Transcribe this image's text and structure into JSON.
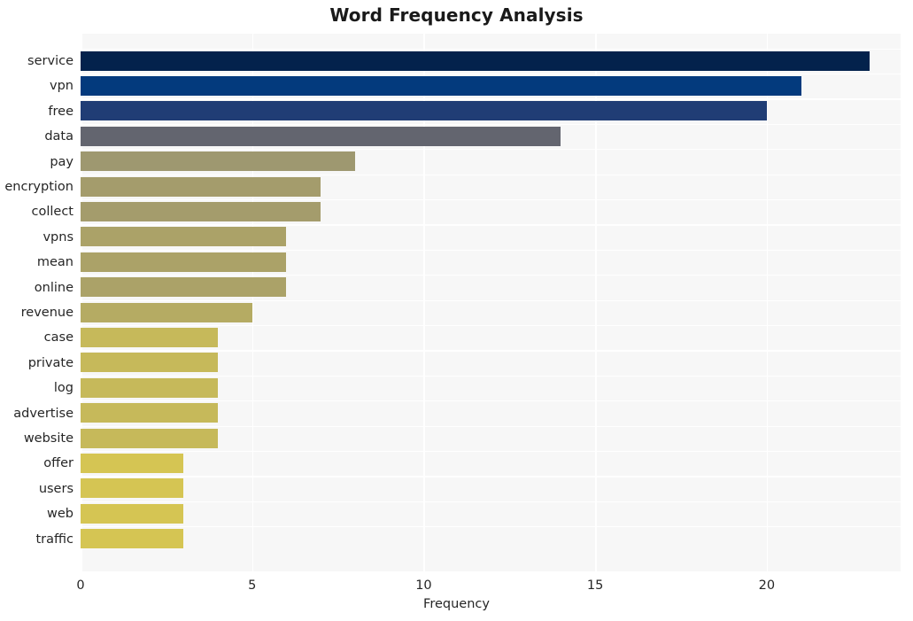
{
  "chart_data": {
    "type": "bar",
    "orientation": "horizontal",
    "title": "Word Frequency Analysis",
    "xlabel": "Frequency",
    "ylabel": "",
    "categories": [
      "service",
      "vpn",
      "free",
      "data",
      "pay",
      "encryption",
      "collect",
      "vpns",
      "mean",
      "online",
      "revenue",
      "case",
      "private",
      "log",
      "advertise",
      "website",
      "offer",
      "users",
      "web",
      "traffic"
    ],
    "values": [
      23,
      21,
      20,
      14,
      8,
      7,
      7,
      6,
      6,
      6,
      5,
      4,
      4,
      4,
      4,
      4,
      3,
      3,
      3,
      3
    ],
    "bar_colors": [
      "#03224c",
      "#033a7d",
      "#203d75",
      "#63656f",
      "#9e9870",
      "#a49c6c",
      "#a49c6c",
      "#ab a2 68",
      "#aba268",
      "#aba268",
      "#b5ab63",
      "#c6b95a",
      "#c6b95a",
      "#c6b95a",
      "#c6b95a",
      "#c6b95a",
      "#d5c553",
      "#d5c553",
      "#d5c553",
      "#d5c553"
    ],
    "xlim": [
      0,
      23.9
    ],
    "xticks": [
      0,
      5,
      10,
      15,
      20
    ],
    "xtick_labels": [
      "0",
      "5",
      "10",
      "15",
      "20"
    ],
    "grid": true,
    "grid_color": "#ffffff",
    "plot_background": "#f7f7f7",
    "legend": null
  }
}
